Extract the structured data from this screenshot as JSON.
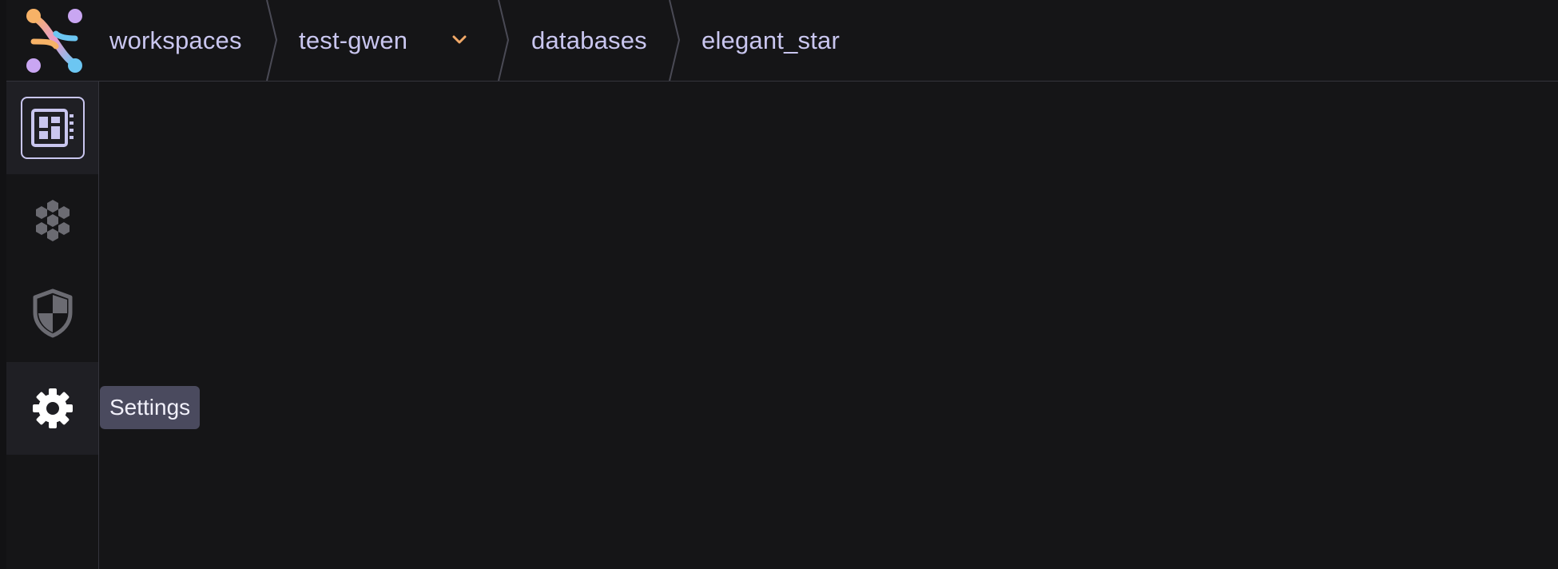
{
  "breadcrumb": {
    "items": [
      {
        "label": "workspaces"
      },
      {
        "label": "test-gwen",
        "has_dropdown": true
      },
      {
        "label": "databases"
      },
      {
        "label": "elegant_star"
      }
    ]
  },
  "sidebar": {
    "items": [
      {
        "icon": "dashboard-icon",
        "state": "active"
      },
      {
        "icon": "hexagon-cluster-icon",
        "state": "default"
      },
      {
        "icon": "shield-icon",
        "state": "default"
      },
      {
        "icon": "gear-icon",
        "state": "hover"
      }
    ]
  },
  "tooltip": {
    "text": "Settings"
  },
  "colors": {
    "background": "#151517",
    "text_primary": "#c9c6ef",
    "accent_orange": "#f0a868",
    "tooltip_bg": "#4a4a5e",
    "icon_muted": "#6b6b72"
  }
}
